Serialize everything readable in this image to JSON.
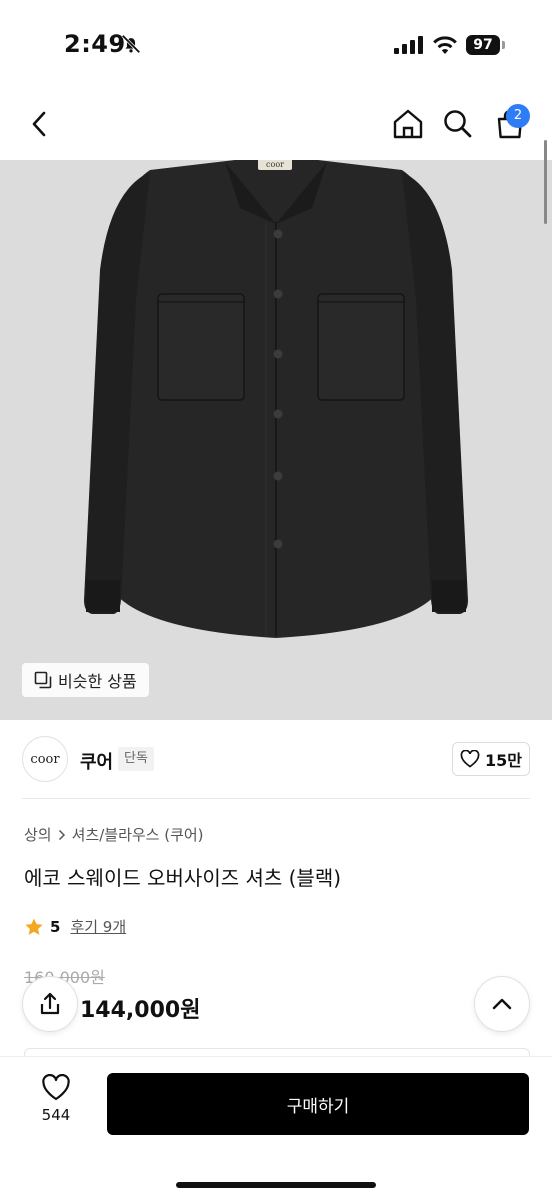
{
  "status_bar": {
    "time": "2:49",
    "battery": "97",
    "icons": [
      "bell-slash-icon",
      "signal-icon",
      "wifi-icon",
      "battery-icon"
    ]
  },
  "nav": {
    "icons": [
      "chevron-left-icon",
      "home-icon",
      "search-icon",
      "shopping-bag-icon"
    ],
    "cart_count": "2"
  },
  "image": {
    "tag_text": "coor",
    "similar_label": "비슷한 상품"
  },
  "brand": {
    "logo_text": "coor",
    "name": "쿠어",
    "badge": "단독",
    "likes": "15만"
  },
  "product": {
    "breadcrumb": [
      "상의",
      "셔츠/블라우스 (쿠어)"
    ],
    "title": "에코 스웨이드 오버사이즈 셔츠 (블랙)",
    "rating": "5",
    "review_label": "후기 9개",
    "original_price": "160,000원",
    "sale_price": "144,000원"
  },
  "bottom": {
    "wish_count": "544",
    "buy_label": "구매하기"
  },
  "colors": {
    "accent": "#2f7df6",
    "star": "#f5a623",
    "buy_button": "#000000",
    "image_bg": "#dcdcdc",
    "shirt": "#262626"
  }
}
